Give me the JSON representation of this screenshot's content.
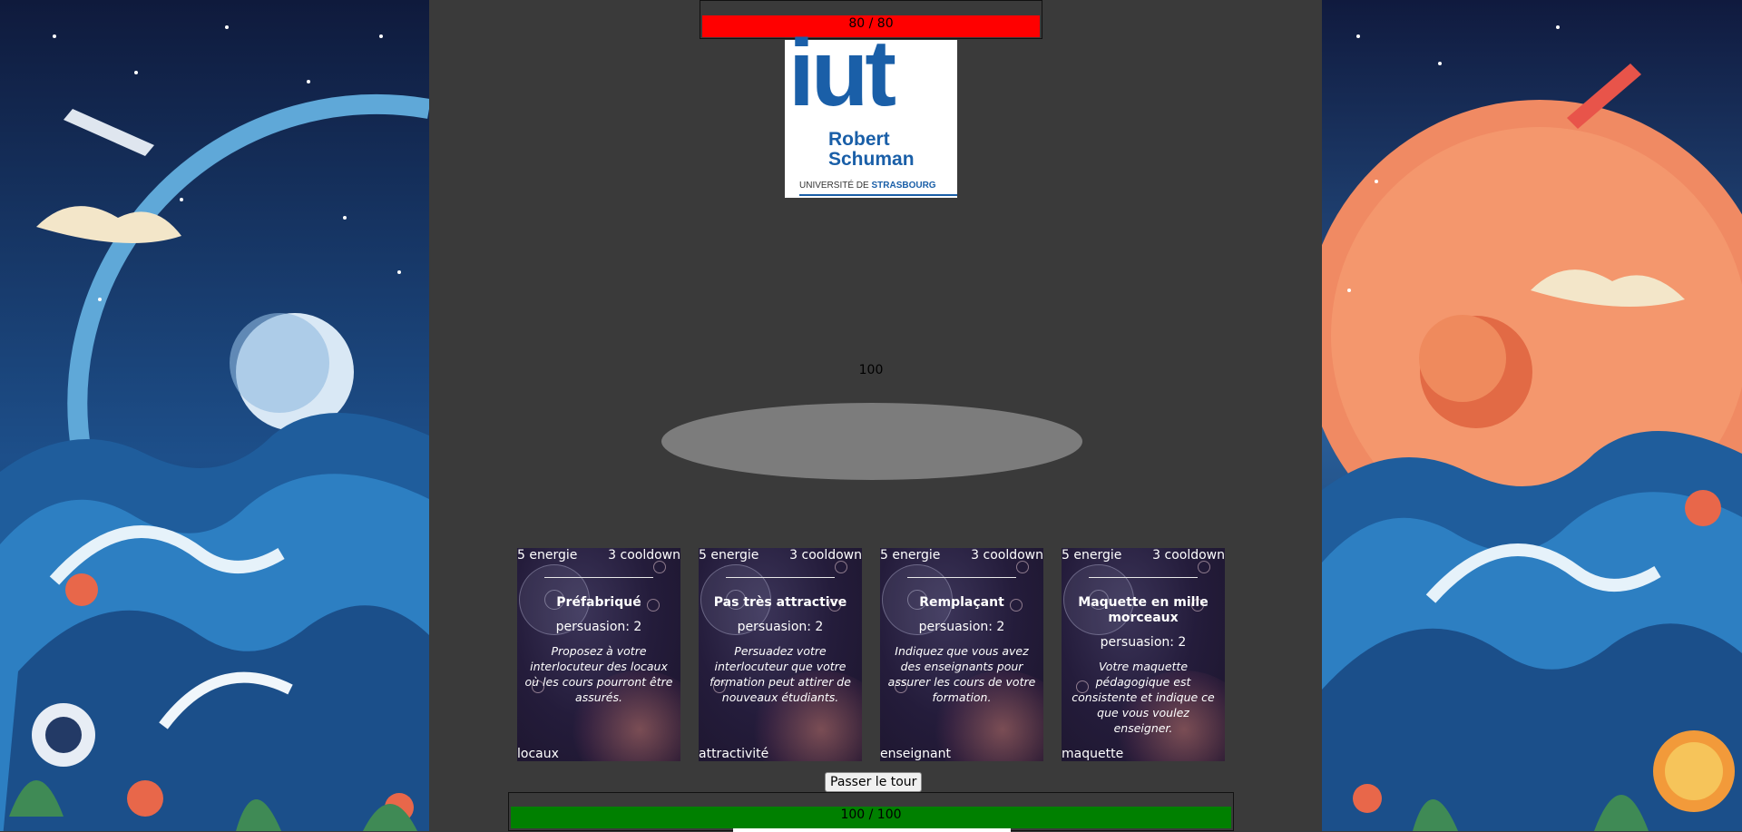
{
  "enemy": {
    "health_label": "80 / 80",
    "health_fraction": 1.0,
    "persuasion_points": "100",
    "bar_color": "#ff0000"
  },
  "logo": {
    "line1": "iut",
    "line2": "Robert",
    "line3": "Schuman",
    "line4_a": "UNIVERSITÉ DE",
    "line4_b": "STRASBOURG",
    "color": "#1a5fa8"
  },
  "cards": [
    {
      "energy": "5 energie",
      "cooldown": "3 cooldown",
      "title": "Préfabriqué",
      "persuasion": "persuasion: 2",
      "description": "Proposez à votre interlocuteur des locaux où les cours pourront être assurés.",
      "tag": "locaux"
    },
    {
      "energy": "5 energie",
      "cooldown": "3 cooldown",
      "title": "Pas très attractive",
      "persuasion": "persuasion: 2",
      "description": "Persuadez votre interlocuteur que votre formation peut attirer de nouveaux étudiants.",
      "tag": "attractivité"
    },
    {
      "energy": "5 energie",
      "cooldown": "3 cooldown",
      "title": "Remplaçant",
      "persuasion": "persuasion: 2",
      "description": "Indiquez que vous avez des enseignants pour assurer les cours de votre formation.",
      "tag": "enseignant"
    },
    {
      "energy": "5 energie",
      "cooldown": "3 cooldown",
      "title": "Maquette en mille morceaux",
      "persuasion": "persuasion: 2",
      "description": "Votre maquette pédagogique est consistente et indique ce que vous voulez enseigner.",
      "tag": "maquette"
    }
  ],
  "actions": {
    "pass_turn": "Passer le tour"
  },
  "player": {
    "health_label": "100 / 100",
    "health_fraction": 1.0,
    "bar_color": "#008000"
  },
  "colors": {
    "background": "#3a3a3a",
    "card_bg": "#241c3b"
  }
}
